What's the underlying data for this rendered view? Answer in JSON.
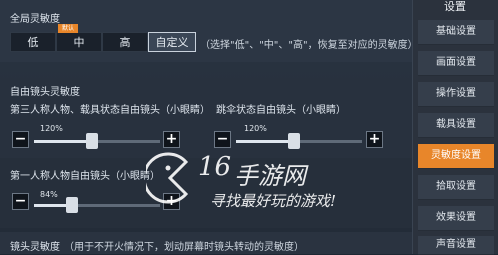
{
  "global_sensitivity": {
    "title": "全局灵敏度",
    "badge": "默认",
    "options": [
      "低",
      "中",
      "高",
      "自定义"
    ],
    "selected": "自定义",
    "note": "（选择\"低\"、\"中\"、\"高\"，恢复至对应的灵敏度）"
  },
  "free_camera": {
    "title": "自由镜头灵敏度",
    "sliders": [
      {
        "label": "第三人称人物、载具状态自由镜头（小眼睛）",
        "value": "120%",
        "level": 1.2
      },
      {
        "label": "跳伞状态自由镜头（小眼睛）",
        "value": "120%",
        "level": 1.2
      },
      {
        "label": "第一人称人物自由镜头（小眼睛）",
        "value": "84%",
        "level": 0.84
      }
    ]
  },
  "camera_sensitivity": {
    "title": "镜头灵敏度",
    "note": "（用于不开火情况下，划动屏幕时镜头转动的灵敏度）"
  },
  "sidebar": {
    "title": "设置",
    "items": [
      "基础设置",
      "画面设置",
      "操作设置",
      "载具设置",
      "灵敏度设置",
      "拾取设置",
      "效果设置",
      "声音设置"
    ],
    "active": "灵敏度设置"
  },
  "watermark": {
    "number": "16",
    "brand": "手游网",
    "slogan": "寻找最好玩的游戏!"
  },
  "colors": {
    "accent": "#e8862a",
    "panel": "#28313e",
    "sidebar": "#2b323d"
  }
}
